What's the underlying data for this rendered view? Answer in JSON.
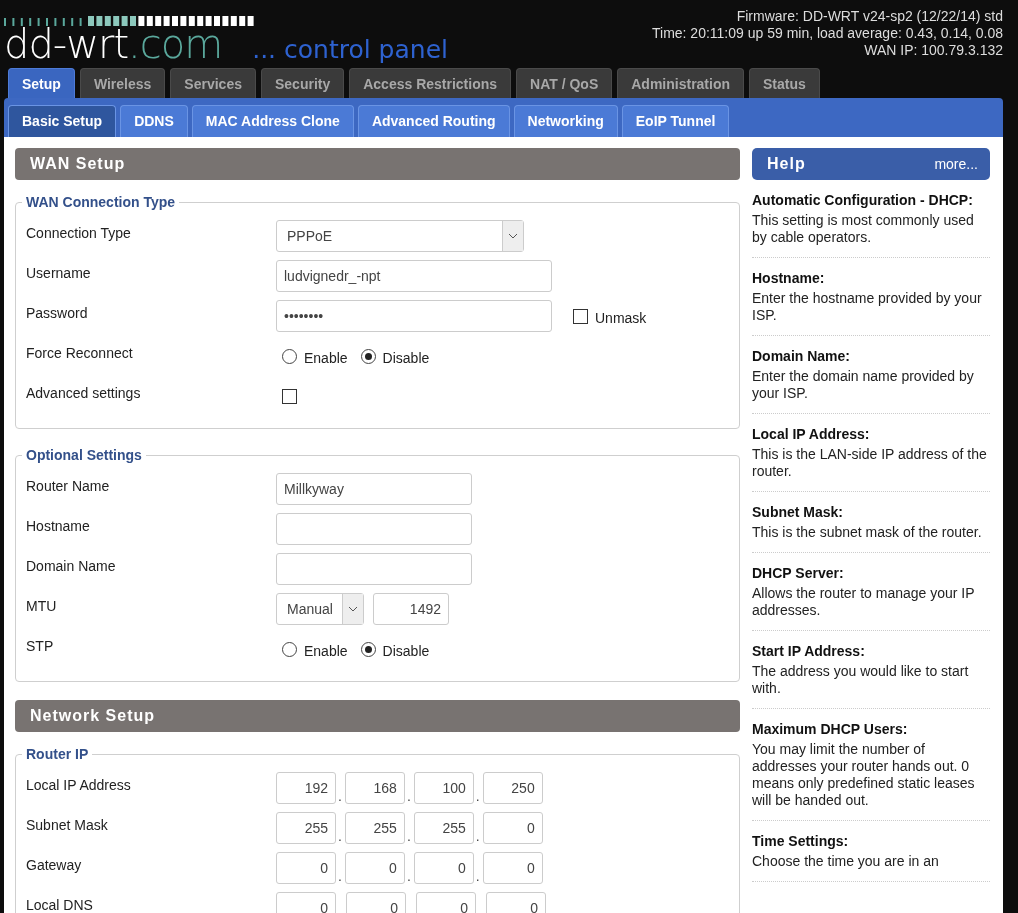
{
  "header": {
    "logo": {
      "name": "dd-wrt",
      "suffix": ".com"
    },
    "tagline": "... control panel",
    "info": [
      "Firmware: DD-WRT v24-sp2 (12/22/14) std",
      "Time: 20:11:09 up 59 min, load average: 0.43, 0.14, 0.08",
      "WAN IP: 100.79.3.132"
    ]
  },
  "tabs": [
    {
      "label": "Setup",
      "selected": true
    },
    {
      "label": "Wireless",
      "selected": false
    },
    {
      "label": "Services",
      "selected": false
    },
    {
      "label": "Security",
      "selected": false
    },
    {
      "label": "Access Restrictions",
      "selected": false
    },
    {
      "label": "NAT / QoS",
      "selected": false
    },
    {
      "label": "Administration",
      "selected": false
    },
    {
      "label": "Status",
      "selected": false
    }
  ],
  "subtabs": [
    {
      "label": "Basic Setup",
      "selected": true
    },
    {
      "label": "DDNS",
      "selected": false
    },
    {
      "label": "MAC Address Clone",
      "selected": false
    },
    {
      "label": "Advanced Routing",
      "selected": false
    },
    {
      "label": "Networking",
      "selected": false
    },
    {
      "label": "EoIP Tunnel",
      "selected": false
    }
  ],
  "sections": [
    {
      "title": "WAN Setup",
      "groups": [
        {
          "legend": "WAN Connection Type",
          "rows": [
            {
              "kind": "select",
              "label": "Connection Type",
              "value": "PPPoE"
            },
            {
              "kind": "text",
              "label": "Username",
              "value": "ludvignedr_-npt"
            },
            {
              "kind": "password",
              "label": "Password",
              "value": "••••••••",
              "unmask": {
                "label": "Unmask",
                "checked": false
              }
            },
            {
              "kind": "radio",
              "label": "Force Reconnect",
              "options": [
                {
                  "label": "Enable",
                  "selected": false
                },
                {
                  "label": "Disable",
                  "selected": true
                }
              ]
            },
            {
              "kind": "checkbox",
              "label": "Advanced settings",
              "checked": false
            }
          ]
        },
        {
          "legend": "Optional Settings",
          "rows": [
            {
              "kind": "short",
              "label": "Router Name",
              "value": "Millkyway"
            },
            {
              "kind": "short",
              "label": "Hostname"
            },
            {
              "kind": "short",
              "label": "Domain Name"
            },
            {
              "kind": "mtu",
              "label": "MTU",
              "mode": "Manual",
              "value": "1492"
            },
            {
              "kind": "radio",
              "label": "STP",
              "options": [
                {
                  "label": "Enable",
                  "selected": false
                },
                {
                  "label": "Disable",
                  "selected": true
                }
              ]
            }
          ]
        }
      ]
    },
    {
      "title": "Network Setup",
      "groups": [
        {
          "legend": "Router IP",
          "rows": [
            {
              "kind": "ip",
              "label": "Local IP Address",
              "octets": [
                "192",
                "168",
                "100",
                "250"
              ],
              "separator": "."
            },
            {
              "kind": "ip",
              "label": "Subnet Mask",
              "octets": [
                "255",
                "255",
                "255",
                "0"
              ],
              "separator": "."
            },
            {
              "kind": "ip",
              "label": "Gateway",
              "octets": [
                "0",
                "0",
                "0",
                "0"
              ],
              "separator": "."
            },
            {
              "kind": "ip",
              "label": "Local DNS",
              "octets": [
                "0",
                "0",
                "0",
                "0"
              ]
            }
          ]
        }
      ]
    }
  ],
  "help": {
    "title": "Help",
    "more": "more...",
    "entries": [
      {
        "title": "Automatic Configuration - DHCP:",
        "text": "This setting is most commonly used by cable operators."
      },
      {
        "title": "Hostname:",
        "text": "Enter the hostname provided by your ISP."
      },
      {
        "title": "Domain Name:",
        "text": "Enter the domain name provided by your ISP."
      },
      {
        "title": "Local IP Address:",
        "text": "This is the LAN-side IP address of the router."
      },
      {
        "title": "Subnet Mask:",
        "text": "This is the subnet mask of the router."
      },
      {
        "title": "DHCP Server:",
        "text": "Allows the router to manage your IP addresses."
      },
      {
        "title": "Start IP Address:",
        "text": "The address you would like to start with."
      },
      {
        "title": "Maximum DHCP Users:",
        "text": "You may limit the number of addresses your router hands out. 0 means only predefined static leases will be handed out."
      },
      {
        "title": "Time Settings:",
        "text": "Choose the time you are in an"
      }
    ]
  }
}
